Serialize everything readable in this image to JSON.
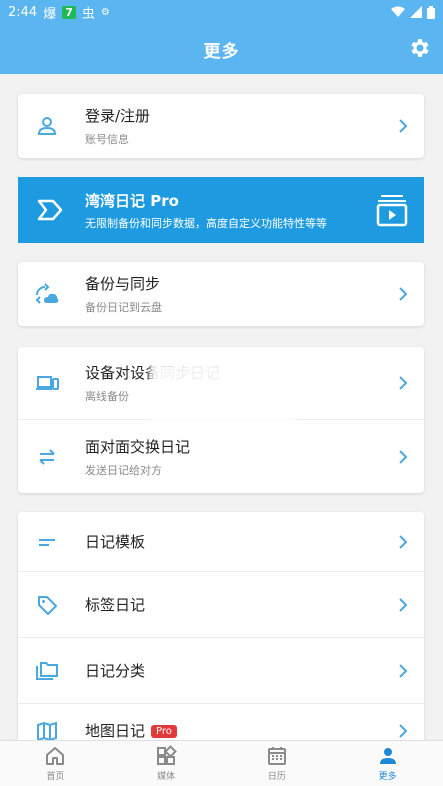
{
  "status": {
    "time": "2:44",
    "notif1": "爆",
    "notif2": "7",
    "notif3": "虫",
    "notif4": "⚙"
  },
  "appbar": {
    "title": "更多"
  },
  "account": {
    "title": "登录/注册",
    "subtitle": "账号信息"
  },
  "pro": {
    "title": "湾湾日记 Pro",
    "subtitle": "无限制备份和同步数据，高度自定义功能特性等等"
  },
  "backup": {
    "title": "备份与同步",
    "subtitle": "备份日记到云盘"
  },
  "device_sync": {
    "title": "设备对设备同步日记",
    "subtitle": "离线备份"
  },
  "f2f": {
    "title": "面对面交换日记",
    "subtitle": "发送日记给对方"
  },
  "tools": [
    {
      "title": "日记模板"
    },
    {
      "title": "标签日记"
    },
    {
      "title": "日记分类"
    },
    {
      "title": "地图日记",
      "tag": "Pro"
    }
  ],
  "nav": [
    {
      "label": "首页"
    },
    {
      "label": "媒体"
    },
    {
      "label": "日历"
    },
    {
      "label": "更多"
    }
  ],
  "colors": {
    "primary": "#5bb5f0",
    "accent": "#1e9be0",
    "icon": "#4aa8e0",
    "pro_tag": "#e23a3a"
  }
}
